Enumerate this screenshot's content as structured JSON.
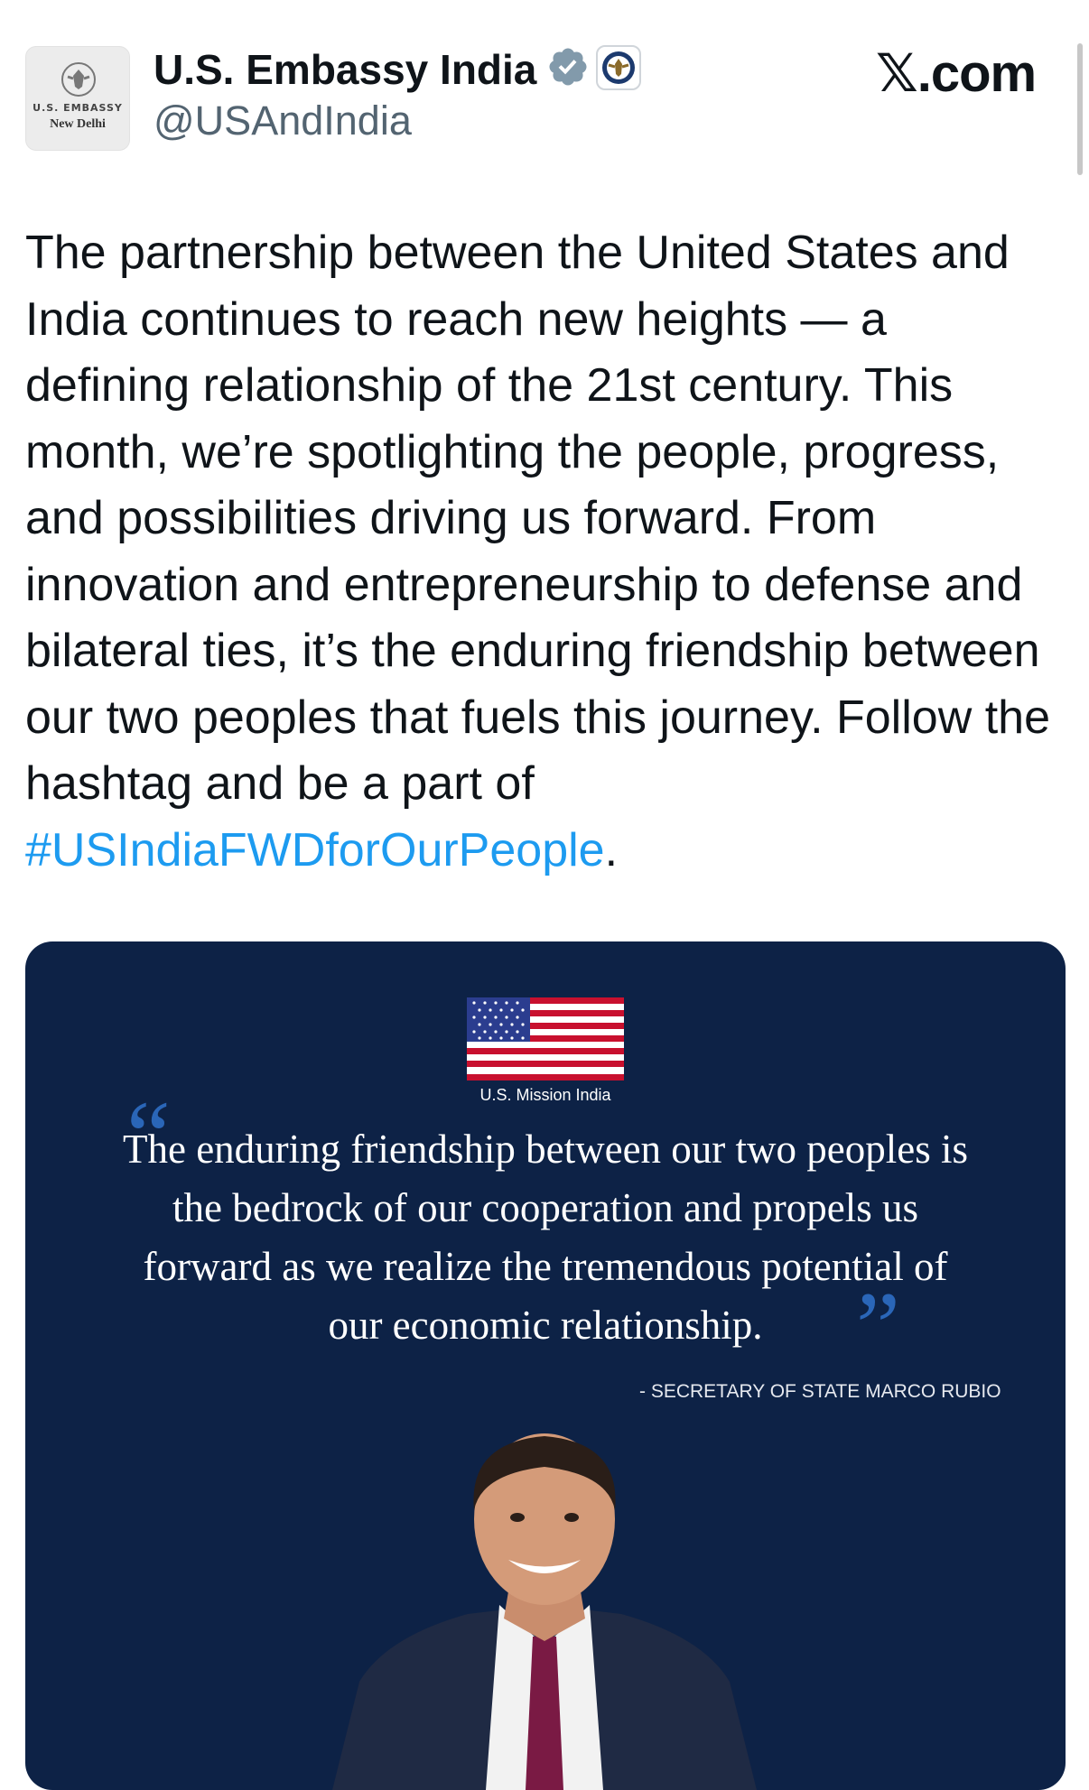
{
  "account": {
    "avatar_line1": "U.S. EMBASSY",
    "avatar_line2": "New Delhi",
    "display_name": "U.S. Embassy India",
    "handle": "@USAndIndia"
  },
  "brand": {
    "x_logo": "𝕏",
    "domain": ".com"
  },
  "tweet": {
    "text": "The partnership between the United States and India continues to reach new heights — a defining relationship of the 21st century. This month, we’re spotlighting the people, progress, and possibilities driving us forward. From innovation and entrepreneurship to defense and bilateral ties, it’s the enduring friendship between our two peoples that fuels this journey. Follow the hashtag and be a part of ",
    "hashtag": "#USIndiaFWDforOurPeople",
    "end_punctuation": "."
  },
  "media": {
    "mission_label": "U.S. Mission India",
    "quote": "The enduring friendship between our two peoples is the bedrock of our cooperation and propels us forward as we realize the tremendous potential of our economic relationship.",
    "attribution": "- SECRETARY OF STATE MARCO RUBIO"
  },
  "colors": {
    "hashtag": "#1d9bf0",
    "media_background": "#0d2246",
    "quote_marks": "#2a66b8",
    "verified_badge": "#829aab"
  },
  "icons": {
    "verified": "verified-badge-icon",
    "affiliate": "state-department-seal-icon"
  }
}
